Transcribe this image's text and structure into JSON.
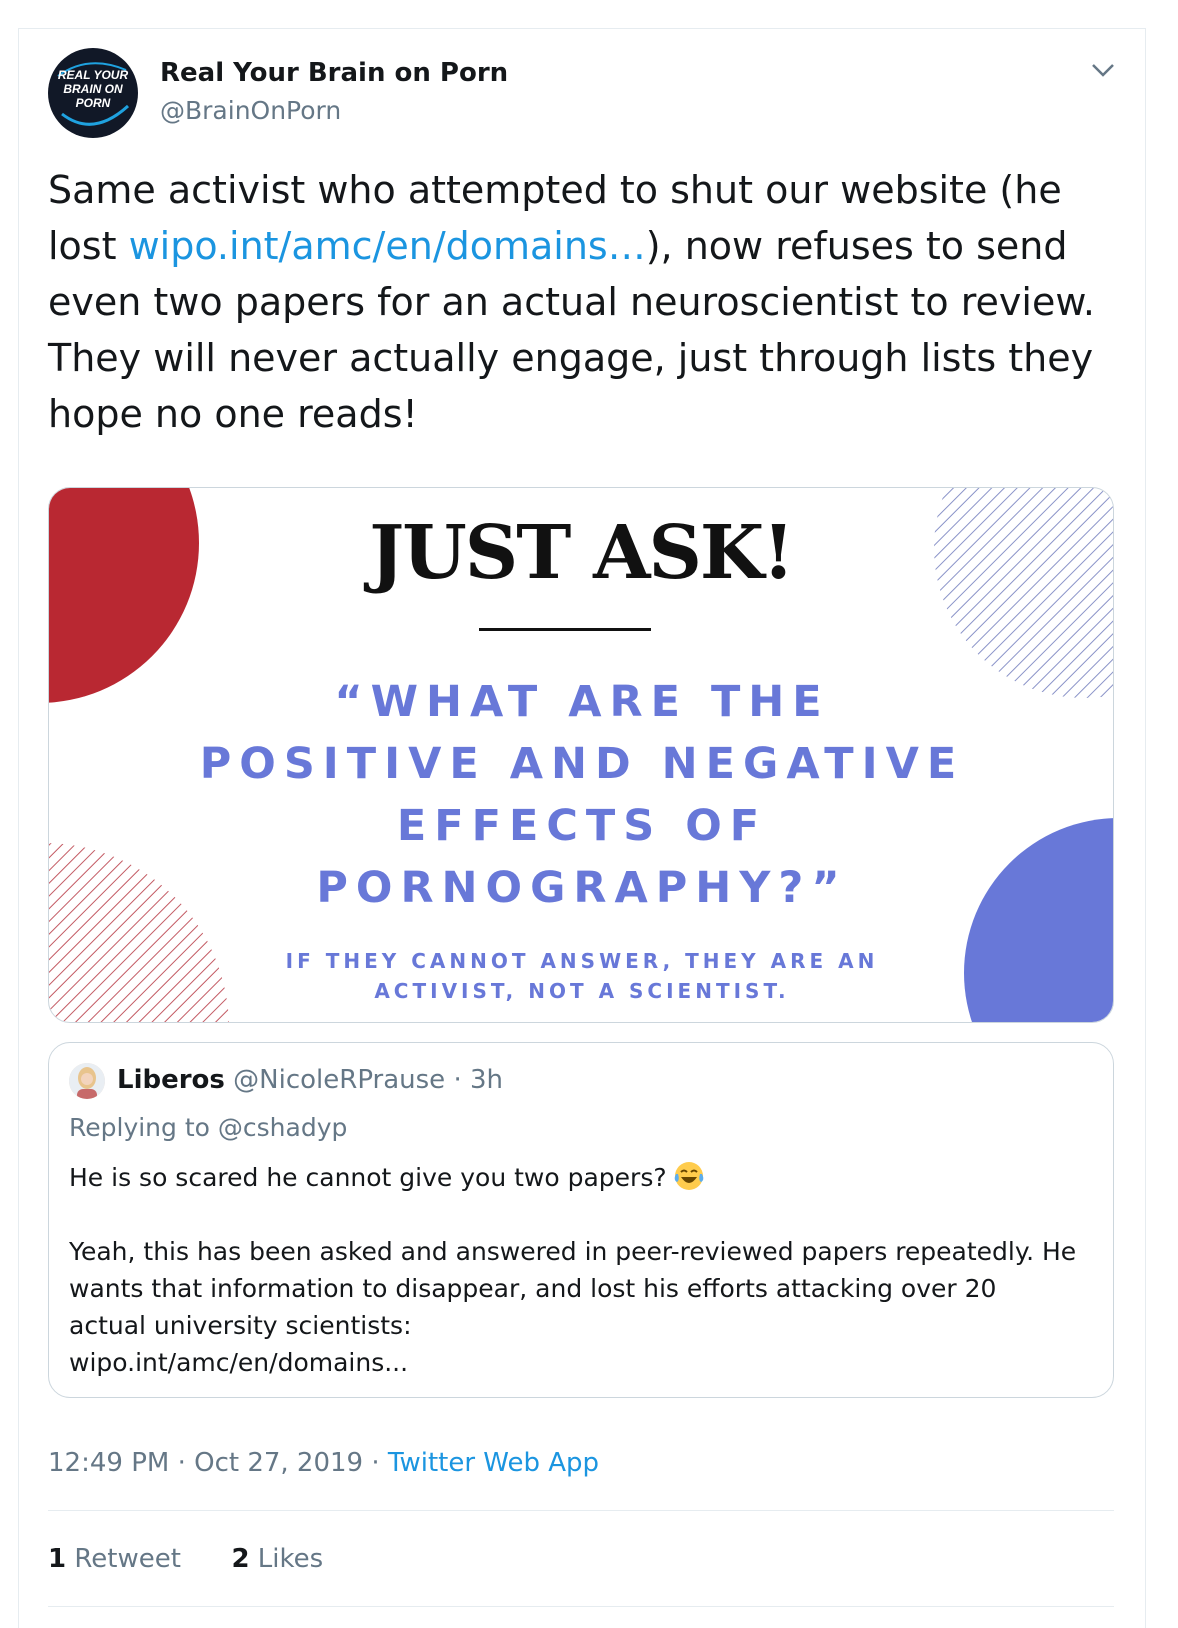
{
  "author": {
    "display_name": "Real Your Brain on Porn",
    "handle": "@BrainOnPorn",
    "avatar_text": "REAL YOUR BRAIN ON PORN"
  },
  "tweet": {
    "text_before_link": "Same activist who attempted to shut our website (he lost ",
    "link_text": "wipo.int/amc/en/domains…",
    "text_after_link": "), now refuses to send even two papers for an actual neuroscientist to review. They will never actually engage, just through lists they hope no one reads!"
  },
  "media": {
    "title": "JUST ASK!",
    "quote": "“WHAT ARE THE POSITIVE AND NEGATIVE EFFECTS OF PORNOGRAPHY?”",
    "subtitle": "IF THEY CANNOT ANSWER, THEY ARE AN ACTIVIST, NOT A SCIENTIST.",
    "colors": {
      "red": "#b92832",
      "blue": "#6878d8"
    }
  },
  "quoted_tweet": {
    "name": "Liberos",
    "handle_time": "@NicoleRPrause · 3h",
    "replying_to": "Replying to @cshadyp",
    "line1": "He is so scared he cannot give you two papers?",
    "emoji": "face-with-tears-of-joy",
    "body": "Yeah, this has been asked and answered in peer-reviewed papers repeatedly. He wants that information to disappear, and lost his efforts attacking over 20 actual university scientists:\nwipo.int/amc/en/domains..."
  },
  "meta": {
    "time_date": "12:49 PM · Oct 27, 2019 · ",
    "source": "Twitter Web App"
  },
  "stats": {
    "retweets_count": "1",
    "retweets_label": "Retweet",
    "likes_count": "2",
    "likes_label": "Likes"
  },
  "colors": {
    "link": "#1b95e0",
    "secondary_text": "#657786",
    "border": "#ccd6dd"
  }
}
